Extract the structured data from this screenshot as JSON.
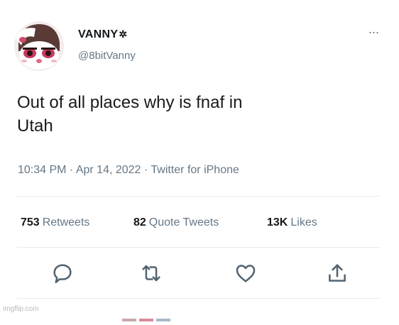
{
  "tweet": {
    "display_name": "VANNY",
    "name_glyph": "✲",
    "handle": "@8bitVanny",
    "more_glyph": "···",
    "text_line1": "Out of all places why is fnaf in",
    "text_line2": "Utah",
    "time": "10:34 PM",
    "date": "Apr 14, 2022",
    "source": "Twitter for iPhone",
    "separator": " · "
  },
  "stats": {
    "retweets_count": "753",
    "retweets_label": "Retweets",
    "quotes_count": "82",
    "quotes_label": "Quote Tweets",
    "likes_count": "13K",
    "likes_label": "Likes"
  },
  "actions": [
    "reply-icon",
    "retweet-icon",
    "like-icon",
    "share-icon"
  ],
  "watermark": "imgflip.com",
  "colors": {
    "secondary_text": "#657786",
    "divider": "#e6ecf0",
    "avatar_pink": "#e06a8a",
    "avatar_brown": "#5a3a36"
  }
}
